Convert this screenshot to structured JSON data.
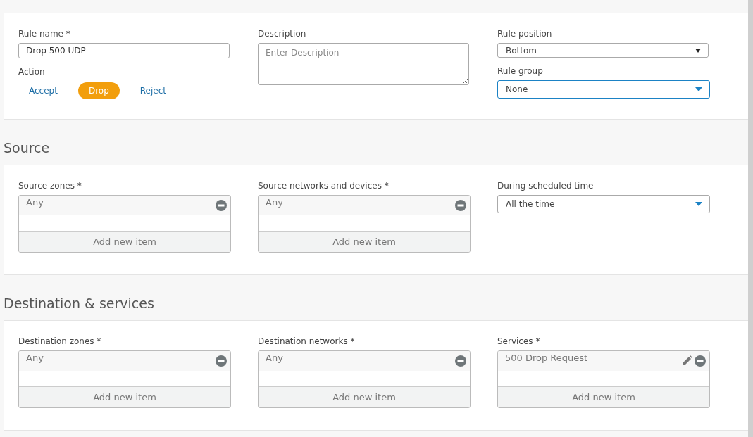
{
  "general": {
    "rule_name": {
      "label": "Rule name *",
      "value": "Drop 500 UDP"
    },
    "action": {
      "label": "Action",
      "options": [
        {
          "label": "Accept",
          "selected": false
        },
        {
          "label": "Drop",
          "selected": true
        },
        {
          "label": "Reject",
          "selected": false
        }
      ]
    },
    "description": {
      "label": "Description",
      "placeholder": "Enter Description"
    },
    "rule_position": {
      "label": "Rule position",
      "value": "Bottom",
      "kind": "native",
      "focused": false
    },
    "rule_group": {
      "label": "Rule group",
      "value": "None",
      "kind": "custom",
      "focused": true
    }
  },
  "sections": [
    {
      "title": "Source",
      "fields": [
        {
          "kind": "list",
          "label": "Source zones *",
          "items": [
            {
              "text": "Any",
              "editable": false
            }
          ],
          "add_label": "Add new item"
        },
        {
          "kind": "list",
          "label": "Source networks and devices *",
          "items": [
            {
              "text": "Any",
              "editable": false
            }
          ],
          "add_label": "Add new item"
        },
        {
          "kind": "select",
          "label": "During scheduled time",
          "value": "All the time",
          "focused": false
        }
      ]
    },
    {
      "title": "Destination & services",
      "fields": [
        {
          "kind": "list",
          "label": "Destination zones *",
          "items": [
            {
              "text": "Any",
              "editable": false
            }
          ],
          "add_label": "Add new item"
        },
        {
          "kind": "list",
          "label": "Destination networks *",
          "items": [
            {
              "text": "Any",
              "editable": false
            }
          ],
          "add_label": "Add new item"
        },
        {
          "kind": "list",
          "label": "Services *",
          "items": [
            {
              "text": "500 Drop Request",
              "editable": true
            }
          ],
          "add_label": "Add new item"
        }
      ]
    }
  ]
}
